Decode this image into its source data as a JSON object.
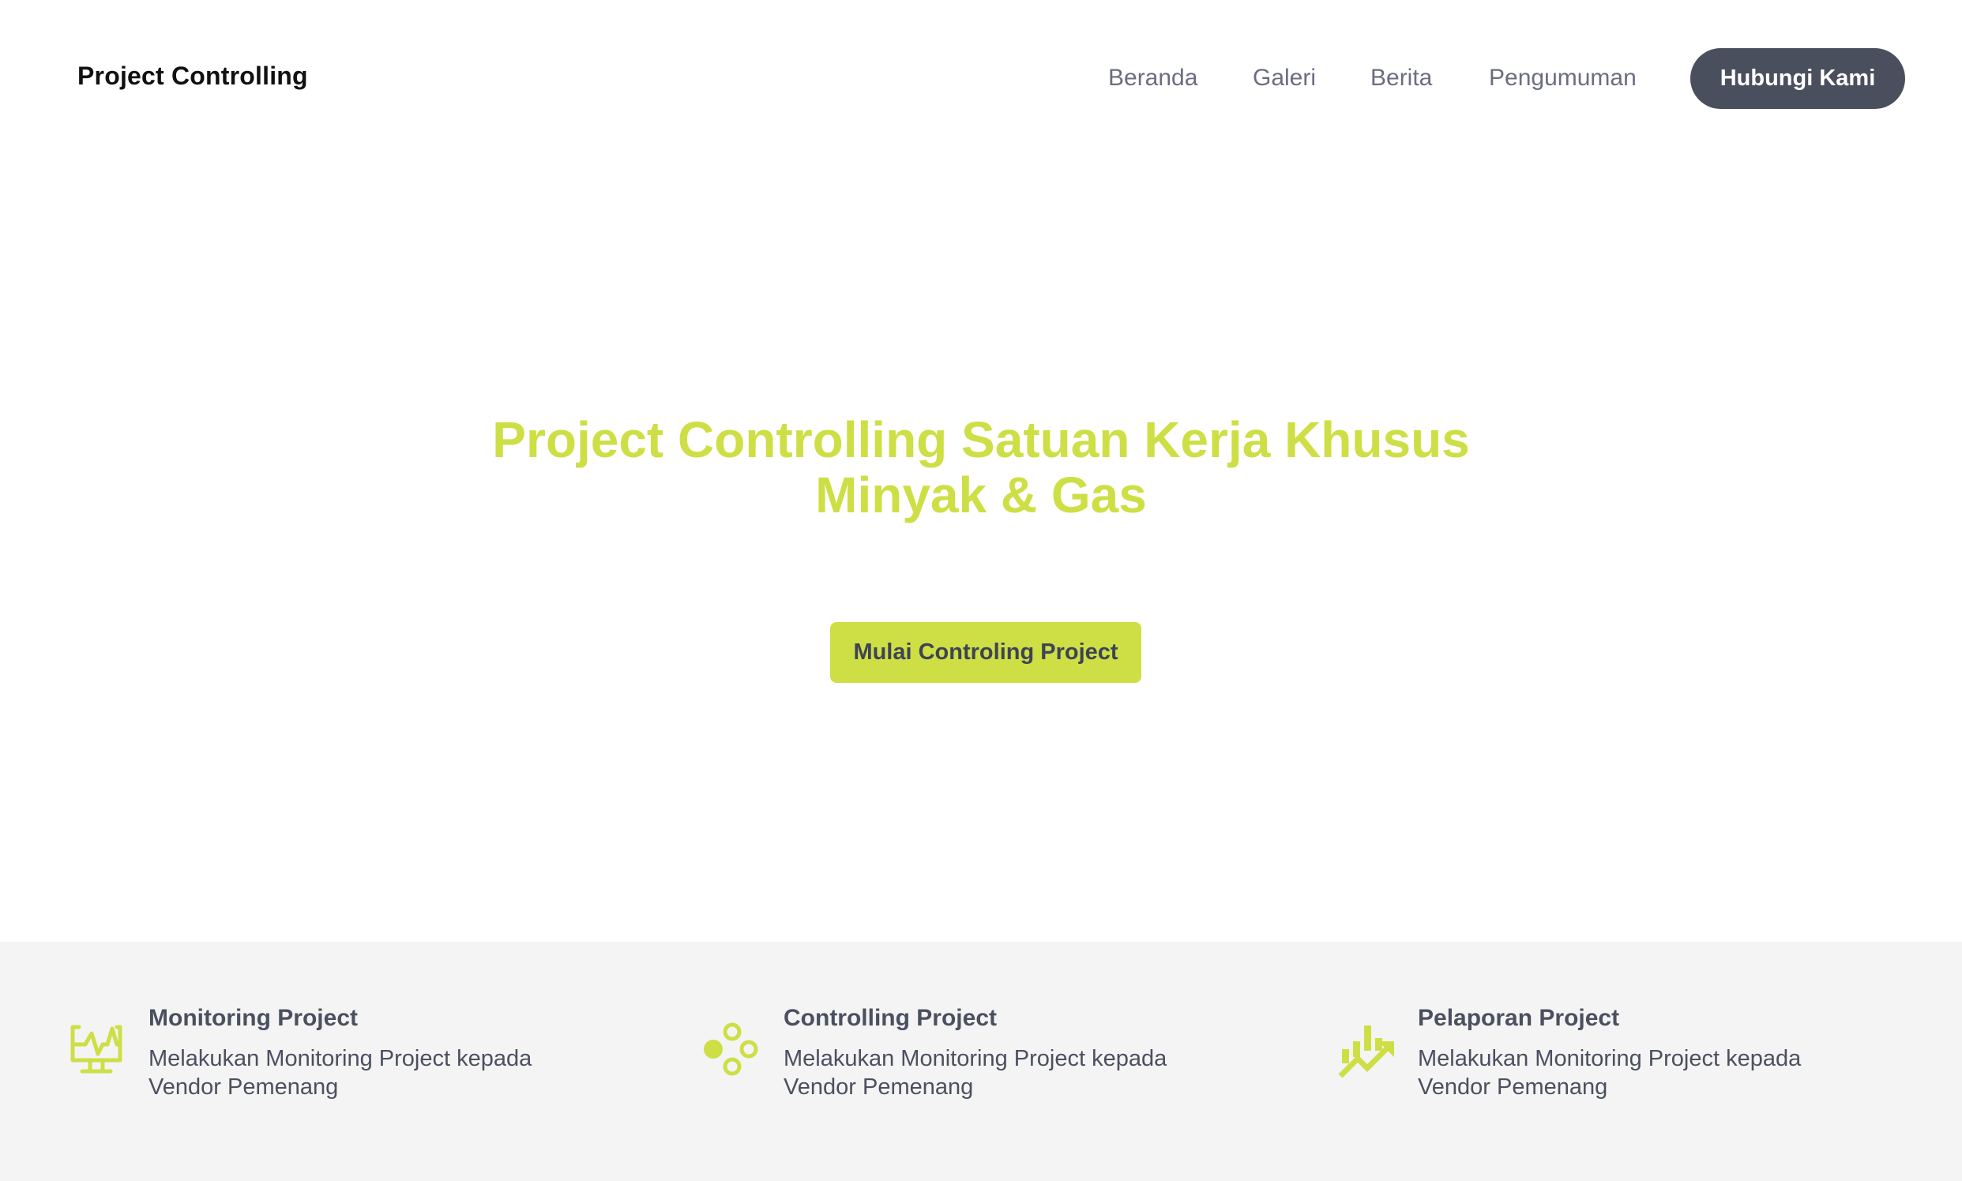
{
  "brand": "Project Controlling",
  "nav": {
    "items": [
      "Beranda",
      "Galeri",
      "Berita",
      "Pengumuman"
    ],
    "cta": "Hubungi Kami"
  },
  "hero": {
    "title_line1": "Project Controlling Satuan Kerja Khusus",
    "title_line2": "Minyak & Gas",
    "cta": "Mulai Controling Project"
  },
  "features": [
    {
      "icon": "monitor-activity-icon",
      "title": "Monitoring Project",
      "desc": "Melakukan Monitoring Project kepada Vendor Pemenang"
    },
    {
      "icon": "circles-cluster-icon",
      "title": "Controlling Project",
      "desc": "Melakukan Monitoring Project kepada Vendor Pemenang"
    },
    {
      "icon": "chart-growth-icon",
      "title": "Pelaporan Project",
      "desc": "Melakukan Monitoring Project kepada Vendor Pemenang"
    }
  ],
  "colors": {
    "accent": "#cddf45",
    "dark": "#4a4f5e",
    "nav_text": "#6b6d80",
    "band_bg": "#f4f4f4"
  }
}
